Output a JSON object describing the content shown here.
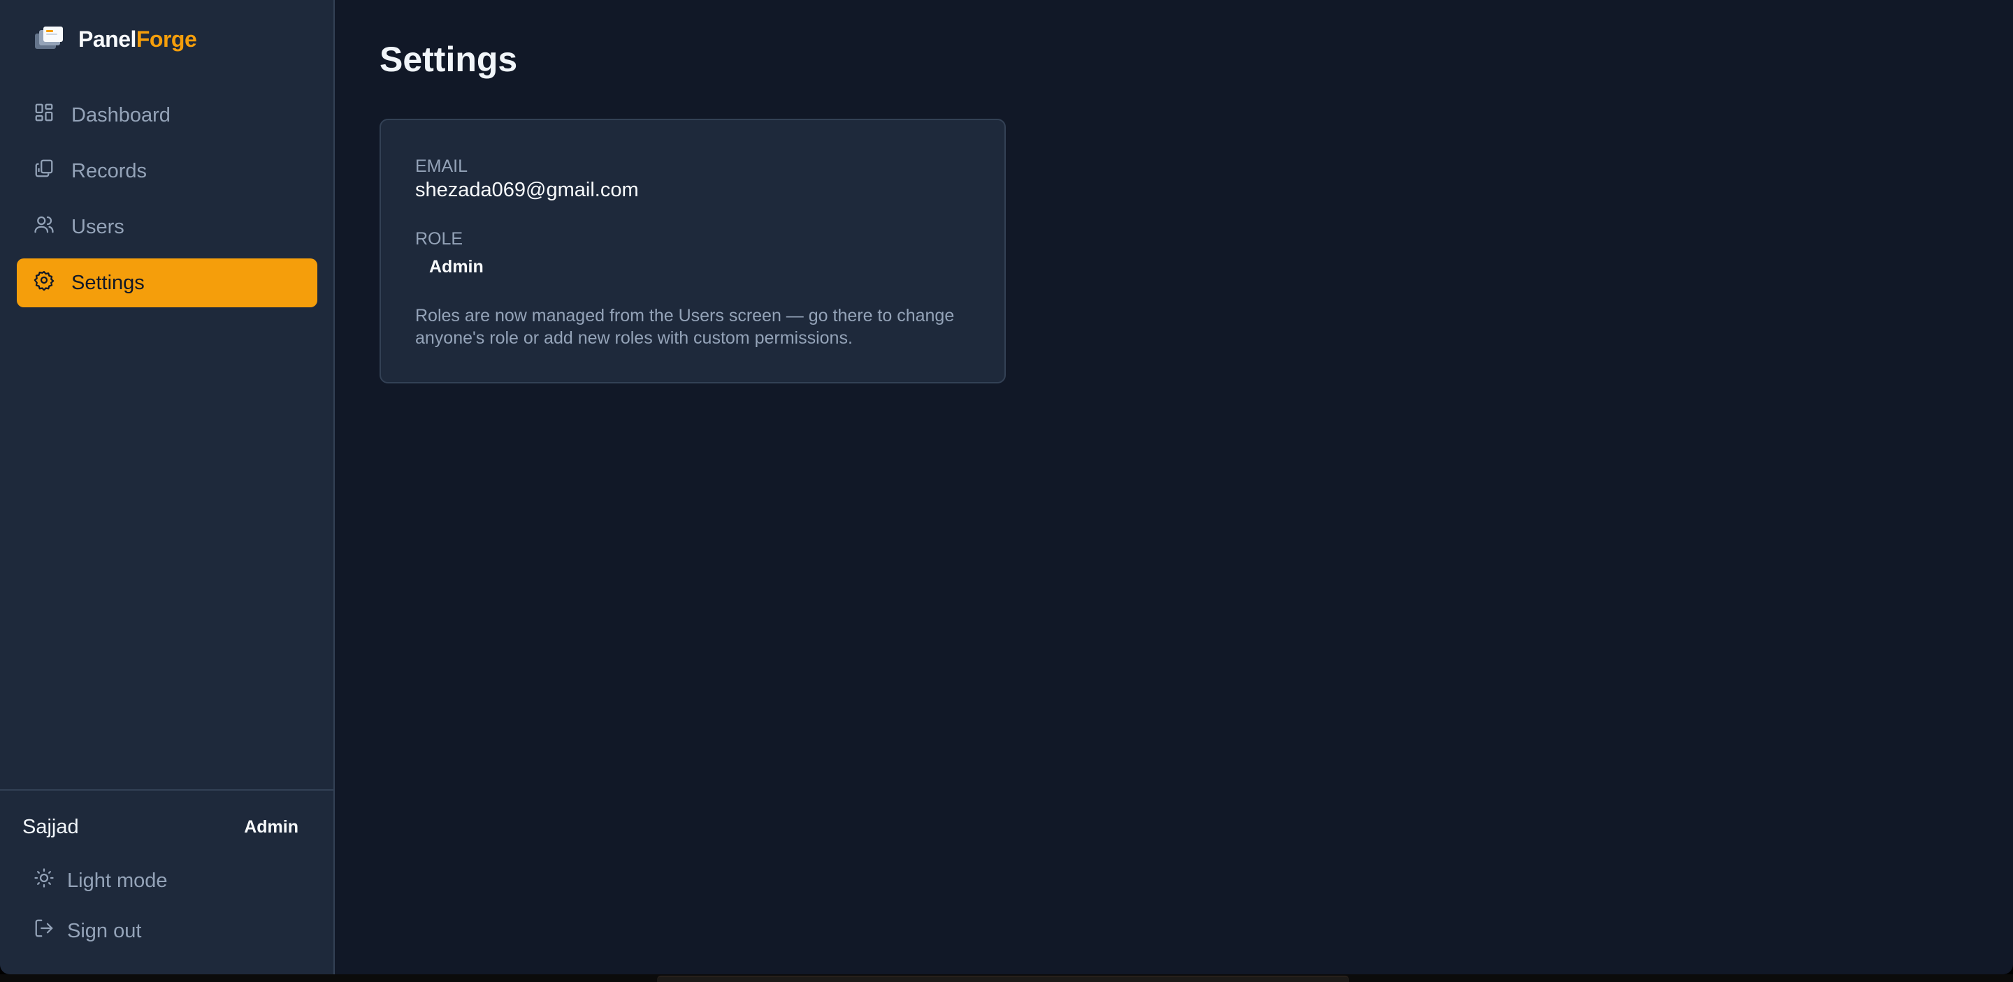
{
  "brand": {
    "part1": "Panel",
    "part2": "Forge",
    "accent": "#f59e0b"
  },
  "nav": {
    "items": [
      {
        "label": "Dashboard",
        "icon": "dashboard-icon",
        "active": false
      },
      {
        "label": "Records",
        "icon": "records-icon",
        "active": false
      },
      {
        "label": "Users",
        "icon": "users-icon",
        "active": false
      },
      {
        "label": "Settings",
        "icon": "gear-icon",
        "active": true
      }
    ]
  },
  "footer": {
    "user_name": "Sajjad",
    "user_role": "Admin",
    "light_mode_label": "Light mode",
    "sign_out_label": "Sign out"
  },
  "page": {
    "title": "Settings"
  },
  "card": {
    "email_label": "EMAIL",
    "email_value": "shezada069@gmail.com",
    "role_label": "ROLE",
    "role_value": "Admin",
    "note": "Roles are now managed from the Users screen — go there to change anyone's role or add new roles with custom permissions."
  }
}
